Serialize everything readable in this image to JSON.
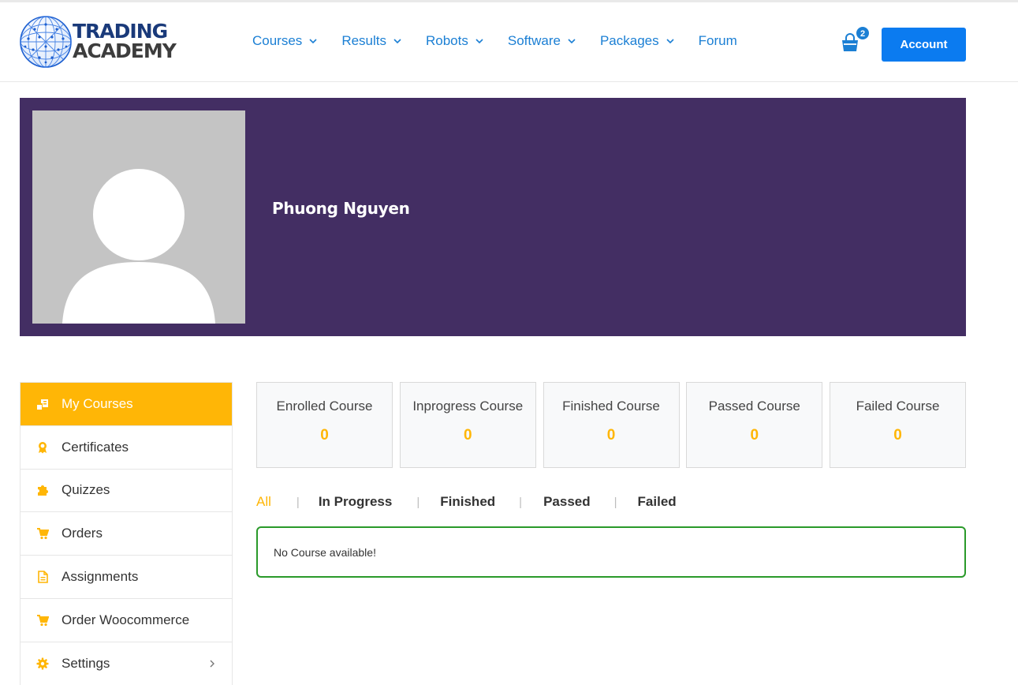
{
  "brand": {
    "logo_line1": "TRADING",
    "logo_line2": "ACADEMY",
    "colors": {
      "navy": "#1a3a7a",
      "link": "#1b7fd4",
      "accent": "#ffb606",
      "banner": "#432e63",
      "button": "#0b7bf0",
      "success": "#2a9a2a"
    }
  },
  "nav": {
    "items": [
      {
        "label": "Courses",
        "dropdown": true
      },
      {
        "label": "Results",
        "dropdown": true
      },
      {
        "label": "Robots",
        "dropdown": true
      },
      {
        "label": "Software",
        "dropdown": true
      },
      {
        "label": "Packages",
        "dropdown": true
      },
      {
        "label": "Forum",
        "dropdown": false
      }
    ],
    "cart_icon": "shopping-bag-icon",
    "cart_count": "2",
    "account_label": "Account"
  },
  "profile": {
    "name": "Phuong Nguyen",
    "avatar_icon": "user-silhouette-icon"
  },
  "sidebar": {
    "items": [
      {
        "label": "My Courses",
        "icon": "courses-icon",
        "active": true
      },
      {
        "label": "Certificates",
        "icon": "award-icon",
        "active": false
      },
      {
        "label": "Quizzes",
        "icon": "puzzle-icon",
        "active": false
      },
      {
        "label": "Orders",
        "icon": "cart-icon",
        "active": false
      },
      {
        "label": "Assignments",
        "icon": "document-icon",
        "active": false
      },
      {
        "label": "Order Woocommerce",
        "icon": "cart-icon",
        "active": false
      },
      {
        "label": "Settings",
        "icon": "gear-icon",
        "active": false,
        "has_submenu": true
      }
    ]
  },
  "stats": [
    {
      "label": "Enrolled Course",
      "value": "0"
    },
    {
      "label": "Inprogress Course",
      "value": "0"
    },
    {
      "label": "Finished Course",
      "value": "0"
    },
    {
      "label": "Passed Course",
      "value": "0"
    },
    {
      "label": "Failed Course",
      "value": "0"
    }
  ],
  "filters": {
    "separator": "|",
    "tabs": [
      {
        "label": "All",
        "active": true
      },
      {
        "label": "In Progress",
        "active": false
      },
      {
        "label": "Finished",
        "active": false
      },
      {
        "label": "Passed",
        "active": false
      },
      {
        "label": "Failed",
        "active": false
      }
    ]
  },
  "empty_message": "No Course available!"
}
